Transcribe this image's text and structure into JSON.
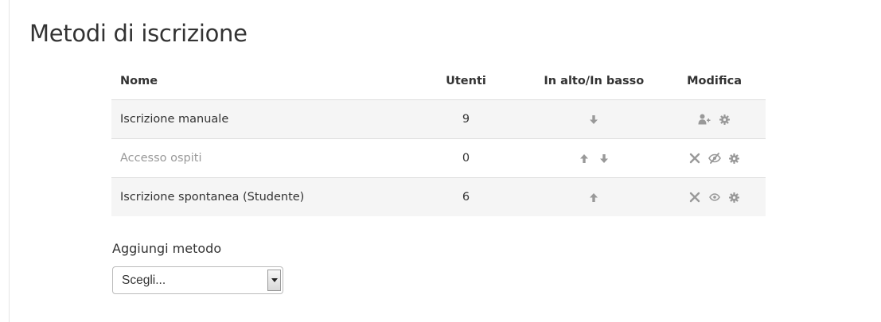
{
  "page": {
    "title": "Metodi di iscrizione"
  },
  "table": {
    "headers": {
      "name": "Nome",
      "users": "Utenti",
      "updown": "In alto/In basso",
      "edit": "Modifica"
    },
    "rows": [
      {
        "name": "Iscrizione manuale",
        "users": "9",
        "enabled": true,
        "updown_icons": [
          "arrow-down-icon"
        ],
        "edit_icons": [
          "enrol-users-icon",
          "settings-gear-icon"
        ]
      },
      {
        "name": "Accesso ospiti",
        "users": "0",
        "enabled": false,
        "updown_icons": [
          "arrow-up-icon",
          "arrow-down-icon"
        ],
        "edit_icons": [
          "delete-x-icon",
          "hidden-eye-slash-icon",
          "settings-gear-icon"
        ]
      },
      {
        "name": "Iscrizione spontanea (Studente)",
        "users": "6",
        "enabled": true,
        "updown_icons": [
          "arrow-up-icon"
        ],
        "edit_icons": [
          "delete-x-icon",
          "visible-eye-icon",
          "settings-gear-icon"
        ]
      }
    ]
  },
  "add_method": {
    "label": "Aggiungi metodo",
    "selected": "Scegli..."
  },
  "colors": {
    "icon": "#999999",
    "stripe": "#f5f5f5",
    "border": "#dddddd",
    "disabled_text": "#999999"
  }
}
